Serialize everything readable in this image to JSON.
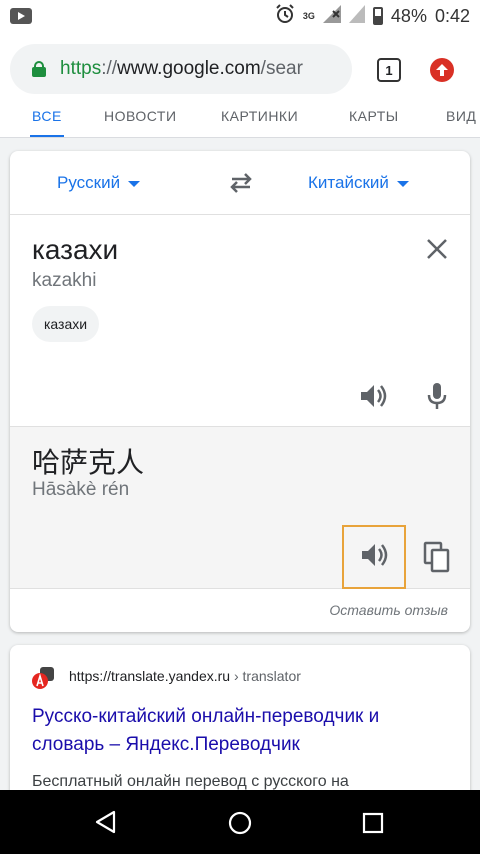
{
  "status_bar": {
    "network": "3G",
    "battery": "48%",
    "time": "0:42"
  },
  "browser": {
    "url_scheme": "https",
    "url_separator": "://",
    "url_host": "www.google.com",
    "url_path": "/sear",
    "tab_count": "1"
  },
  "search_tabs": [
    {
      "label": "ВСЕ",
      "active": true
    },
    {
      "label": "НОВОСТИ",
      "active": false
    },
    {
      "label": "КАРТИНКИ",
      "active": false
    },
    {
      "label": "КАРТЫ",
      "active": false
    },
    {
      "label": "ВИД",
      "active": false
    }
  ],
  "translator": {
    "source_language": "Русский",
    "target_language": "Китайский",
    "source_text": "казахи",
    "source_transliteration": "kazakhi",
    "suggestion_chip": "казахи",
    "target_text": "哈萨克人",
    "target_transliteration": "Hāsàkè rén",
    "feedback_label": "Оставить отзыв"
  },
  "result": {
    "url_host": "https://translate.yandex.ru",
    "url_crumb": " › translator",
    "title": "Русско-китайский онлайн-переводчик и словарь – Яндекс.Переводчик",
    "snippet": "Бесплатный онлайн перевод с русского на"
  },
  "colors": {
    "accent": "#1a73e8",
    "link_title": "#1a0dab",
    "secure_green": "#1e8e3e",
    "focus_outline": "#e8a33a",
    "update_badge": "#d93025"
  }
}
